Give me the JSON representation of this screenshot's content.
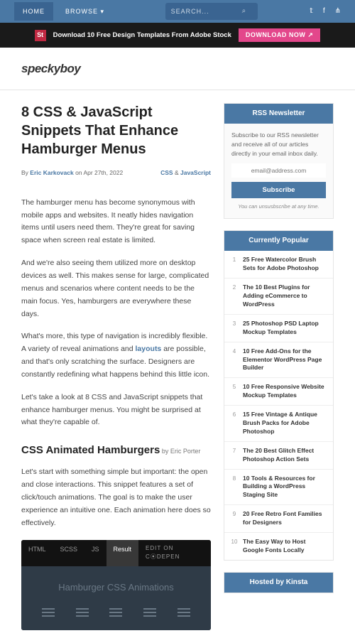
{
  "topnav": {
    "home": "HOME",
    "browse": "BROWSE ▾"
  },
  "search": {
    "placeholder": "SEARCH..."
  },
  "banner": {
    "badge": "St",
    "text": "Download 10 Free Design Templates From Adobe Stock",
    "cta": "DOWNLOAD NOW ↗"
  },
  "logo": "speckyboy",
  "article": {
    "title": "8 CSS & JavaScript Snippets That Enhance Hamburger Menus",
    "byPrefix": "By ",
    "author": "Eric Karkovack",
    "datePrefix": " on ",
    "date": "Apr 27th, 2022",
    "cat1": "CSS",
    "catSep": " & ",
    "cat2": "JavaScript",
    "p1": "The hamburger menu has become synonymous with mobile apps and websites. It neatly hides navigation items until users need them. They're great for saving space when screen real estate is limited.",
    "p2": "And we're also seeing them utilized more on desktop devices as well. This makes sense for large, complicated menus and scenarios where content needs to be the main focus. Yes, hamburgers are everywhere these days.",
    "p3a": "What's more, this type of navigation is incredibly flexible. A variety of reveal animations and ",
    "p3link": "layouts",
    "p3b": " are possible, and that's only scratching the surface. Designers are constantly redefining what happens behind this little icon.",
    "p4": "Let's take a look at 8 CSS and JavaScript snippets that enhance hamburger menus. You might be surprised at what they're capable of.",
    "h2": "CSS Animated Hamburgers",
    "h2by": " by Eric Porter",
    "p5": "Let's start with something simple but important: the open and close interactions. This snippet features a set of click/touch animations. The goal is to make the user experience an intuitive one. Each animation here does so effectively."
  },
  "codepen": {
    "tabs": [
      "HTML",
      "SCSS",
      "JS",
      "Result"
    ],
    "edit": "EDIT ON C⦿DEPEN",
    "title": "Hamburger CSS Animations"
  },
  "rss": {
    "head": "RSS Newsletter",
    "text": "Subscribe to our RSS newsletter and receive all of our articles directly in your email inbox daily.",
    "placeholder": "email@address.com",
    "btn": "Subscribe",
    "note": "You can unsusbscribe at any time."
  },
  "popular": {
    "head": "Currently Popular",
    "items": [
      "25 Free Watercolor Brush Sets for Adobe Photoshop",
      "The 10 Best Plugins for Adding eCommerce to WordPress",
      "25 Photoshop PSD Laptop Mockup Templates",
      "10 Free Add-Ons for the Elementor WordPress Page Builder",
      "10 Free Responsive Website Mockup Templates",
      "15 Free Vintage & Antique Brush Packs for Adobe Photoshop",
      "The 20 Best Glitch Effect Photoshop Action Sets",
      "10 Tools & Resources for Building a WordPress Staging Site",
      "20 Free Retro Font Families for Designers",
      "The Easy Way to Host Google Fonts Locally"
    ]
  },
  "kinsta": {
    "head": "Hosted by Kinsta"
  }
}
